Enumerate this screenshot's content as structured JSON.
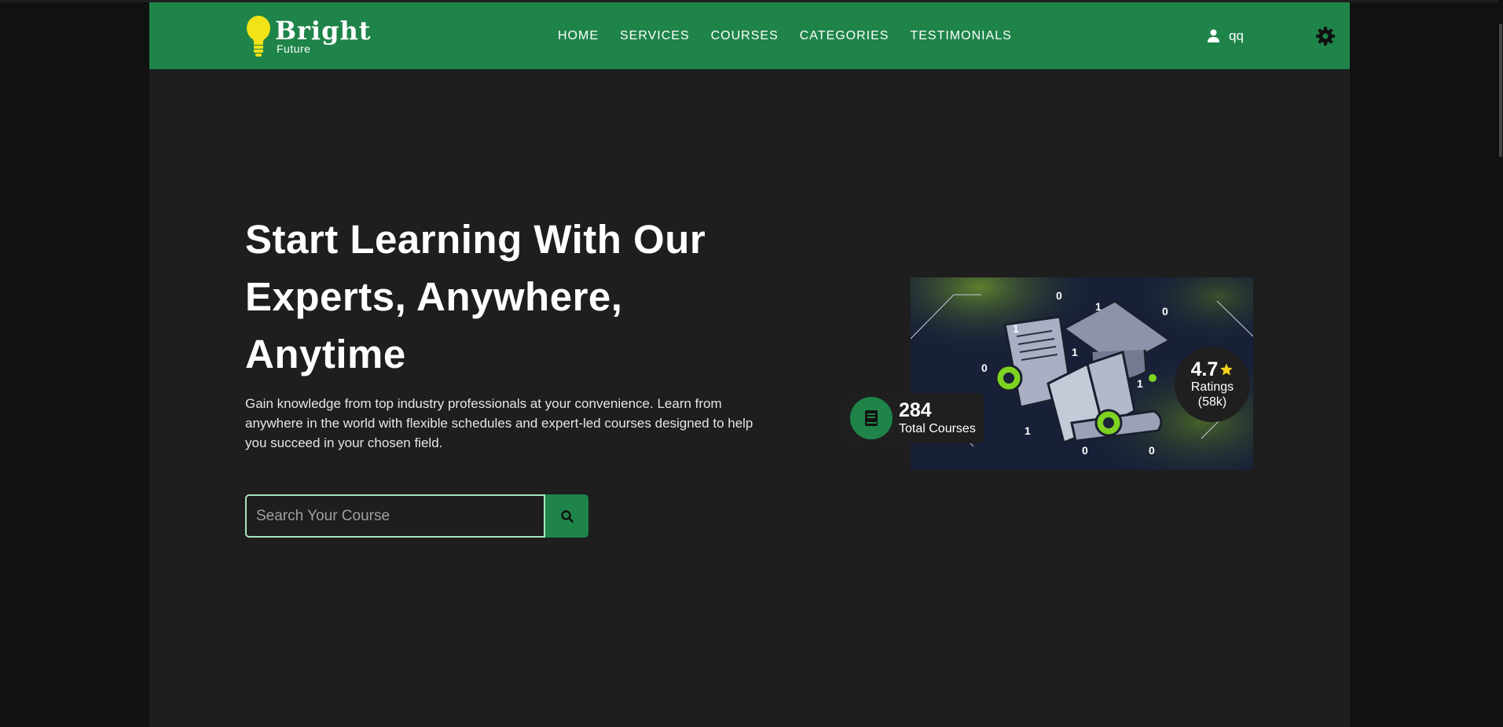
{
  "brand": {
    "name": "Bright",
    "tagline": "Future",
    "bulb_color": "#f2e316",
    "header_color": "#1e8449"
  },
  "nav": {
    "links": [
      {
        "label": "HOME"
      },
      {
        "label": "SERVICES"
      },
      {
        "label": "COURSES"
      },
      {
        "label": "CATEGORIES"
      },
      {
        "label": "TESTIMONIALS"
      }
    ]
  },
  "user": {
    "name": "qq",
    "icon": "user-icon"
  },
  "settings": {
    "icon": "gear-icon"
  },
  "hero": {
    "title": "Start Learning With Our Experts, Anywhere, Anytime",
    "description": "Gain knowledge from top industry professionals at your convenience. Learn from anywhere in the world with flexible schedules and expert-led courses designed to help you succeed in your chosen field.",
    "search": {
      "placeholder": "Search Your Course",
      "value": "",
      "button_icon": "search-icon"
    }
  },
  "stats": {
    "courses": {
      "count": "284",
      "label": "Total Courses",
      "icon": "book-icon"
    },
    "rating": {
      "value": "4.7",
      "label": "Ratings",
      "count": "(58k)",
      "icon": "star-icon",
      "star_color": "#f2d21b"
    }
  }
}
